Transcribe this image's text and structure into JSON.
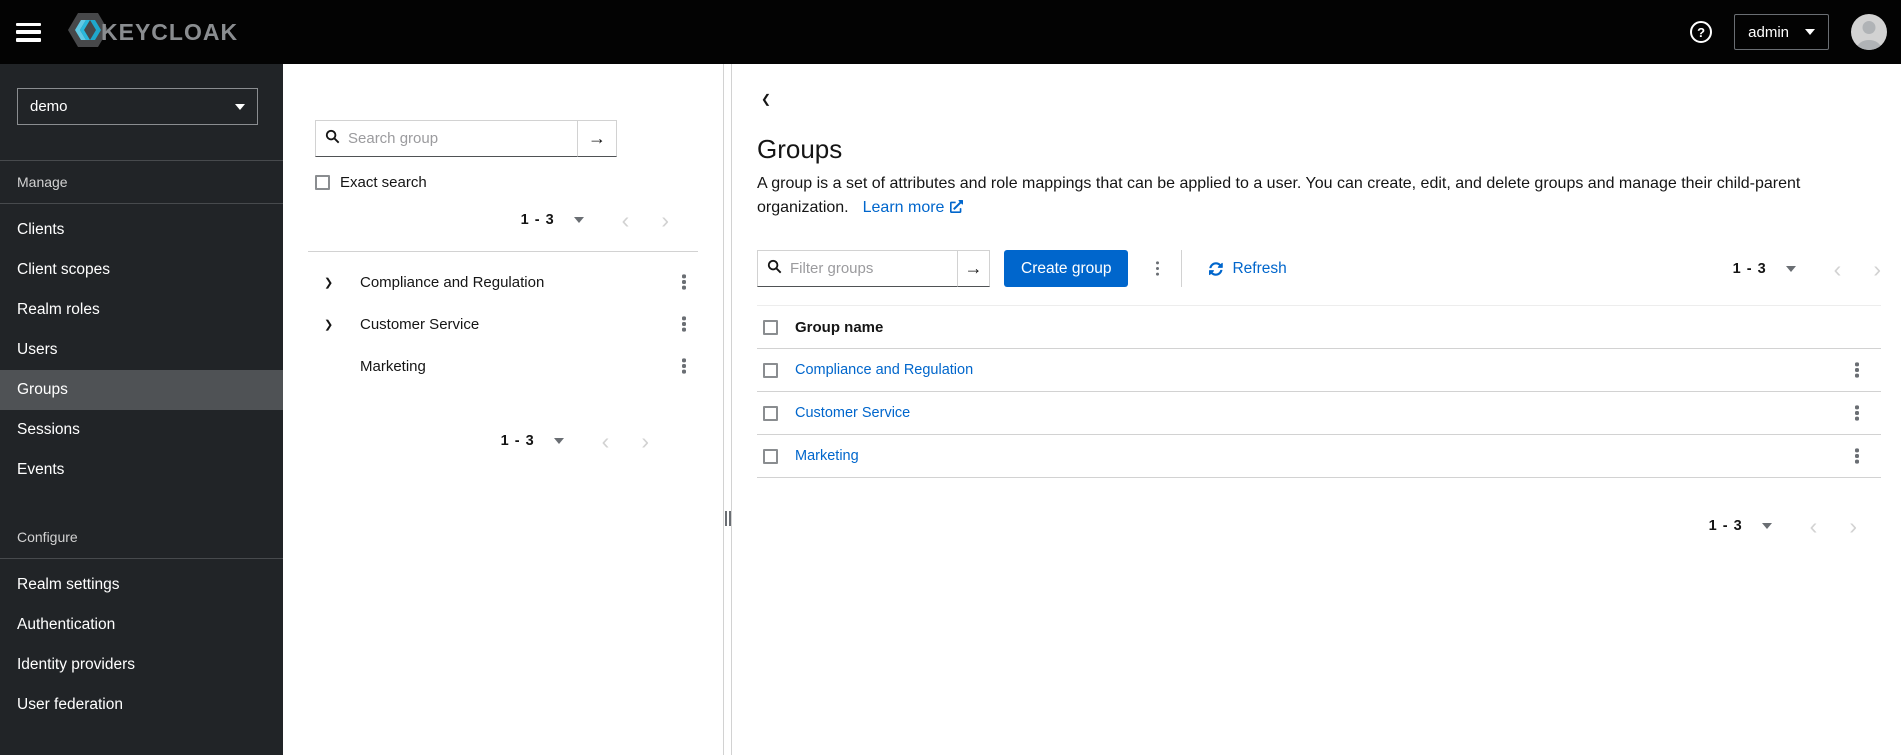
{
  "header": {
    "brand": "KEYCLOAK",
    "user_menu_label": "admin"
  },
  "sidebar": {
    "realm_selector_value": "demo",
    "sections": [
      {
        "label": "Manage",
        "items": [
          {
            "label": "Clients",
            "active": false
          },
          {
            "label": "Client scopes",
            "active": false
          },
          {
            "label": "Realm roles",
            "active": false
          },
          {
            "label": "Users",
            "active": false
          },
          {
            "label": "Groups",
            "active": true
          },
          {
            "label": "Sessions",
            "active": false
          },
          {
            "label": "Events",
            "active": false
          }
        ]
      },
      {
        "label": "Configure",
        "items": [
          {
            "label": "Realm settings",
            "active": false
          },
          {
            "label": "Authentication",
            "active": false
          },
          {
            "label": "Identity providers",
            "active": false
          },
          {
            "label": "User federation",
            "active": false
          }
        ]
      }
    ]
  },
  "tree_panel": {
    "search_placeholder": "Search group",
    "exact_search_label": "Exact search",
    "exact_search_checked": false,
    "pagination_top": {
      "range": "1 - 3"
    },
    "pagination_bottom": {
      "range": "1 - 3"
    },
    "groups": [
      {
        "label": "Compliance and Regulation",
        "expandable": true
      },
      {
        "label": "Customer Service",
        "expandable": true
      },
      {
        "label": "Marketing",
        "expandable": false
      }
    ]
  },
  "main": {
    "title": "Groups",
    "description": "A group is a set of attributes and role mappings that can be applied to a user. You can create, edit, and delete groups and manage their child-parent organization.",
    "learn_more_label": "Learn more",
    "toolbar": {
      "filter_placeholder": "Filter groups",
      "create_button_label": "Create group",
      "refresh_label": "Refresh",
      "pagination": {
        "range": "1 - 3"
      }
    },
    "table": {
      "header": "Group name",
      "rows": [
        {
          "name": "Compliance and Regulation"
        },
        {
          "name": "Customer Service"
        },
        {
          "name": "Marketing"
        }
      ]
    },
    "pagination_bottom": {
      "range": "1 - 3"
    }
  },
  "icons": {
    "hamburger": "≡",
    "help": "?",
    "search": "magnifier",
    "arrow_right": "→",
    "kebab": "⋮",
    "caret_down": "▾",
    "chevron_left": "‹",
    "chevron_right": "›",
    "tree_chevron": "❯",
    "back_chevron": "❮",
    "refresh": "sync-arrows",
    "external_link": "box-arrow",
    "resize_grip": "‖"
  },
  "colors": {
    "primary": "#0066cc",
    "link": "#0066cc",
    "masthead_bg": "#030303",
    "sidebar_bg": "#212427",
    "sidebar_active_bg": "#4f5255",
    "logo_cyan": "#3cbde5",
    "text": "#151515",
    "muted_icon": "#6a6e73",
    "border": "#d2d2d2",
    "disabled_chevron": "#d2d2d2"
  }
}
